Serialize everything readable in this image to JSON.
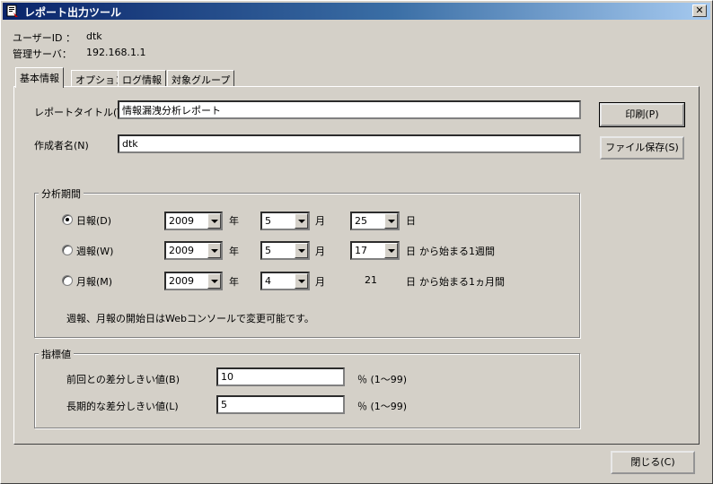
{
  "window": {
    "title": "レポート出力ツール"
  },
  "info": {
    "user_label": "ユーザーID ：",
    "user_value": "dtk",
    "server_label": "管理サーバ：",
    "server_value": "192.168.1.1"
  },
  "tabs": [
    {
      "label": "基本情報",
      "active": true
    },
    {
      "label": "オプション"
    },
    {
      "label": "ログ情報"
    },
    {
      "label": "対象グループ"
    }
  ],
  "form": {
    "report_title_label": "レポートタイトル(T)",
    "report_title_value": "情報漏洩分析レポート",
    "author_label": "作成者名(N)",
    "author_value": "dtk"
  },
  "buttons": {
    "print": "印刷(P)",
    "save": "ファイル保存(S)",
    "close": "閉じる(C)"
  },
  "period": {
    "title": "分析期間",
    "year_unit": "年",
    "month_unit": "月",
    "day_unit": "日",
    "daily": {
      "label": "日報(D)",
      "year": "2009",
      "month": "5",
      "day": "25",
      "suffix": ""
    },
    "weekly": {
      "label": "週報(W)",
      "year": "2009",
      "month": "5",
      "day": "17",
      "suffix": "から始まる1週間"
    },
    "monthly": {
      "label": "月報(M)",
      "year": "2009",
      "month": "4",
      "day": "21",
      "suffix": "から始まる1ヵ月間"
    },
    "note": "週報、月報の開始日はWebコンソールで変更可能です。"
  },
  "indicator": {
    "title": "指標値",
    "prev_label": "前回との差分しきい値(B)",
    "prev_value": "10",
    "long_label": "長期的な差分しきい値(L)",
    "long_value": "5",
    "range": "％ (1～99)"
  }
}
